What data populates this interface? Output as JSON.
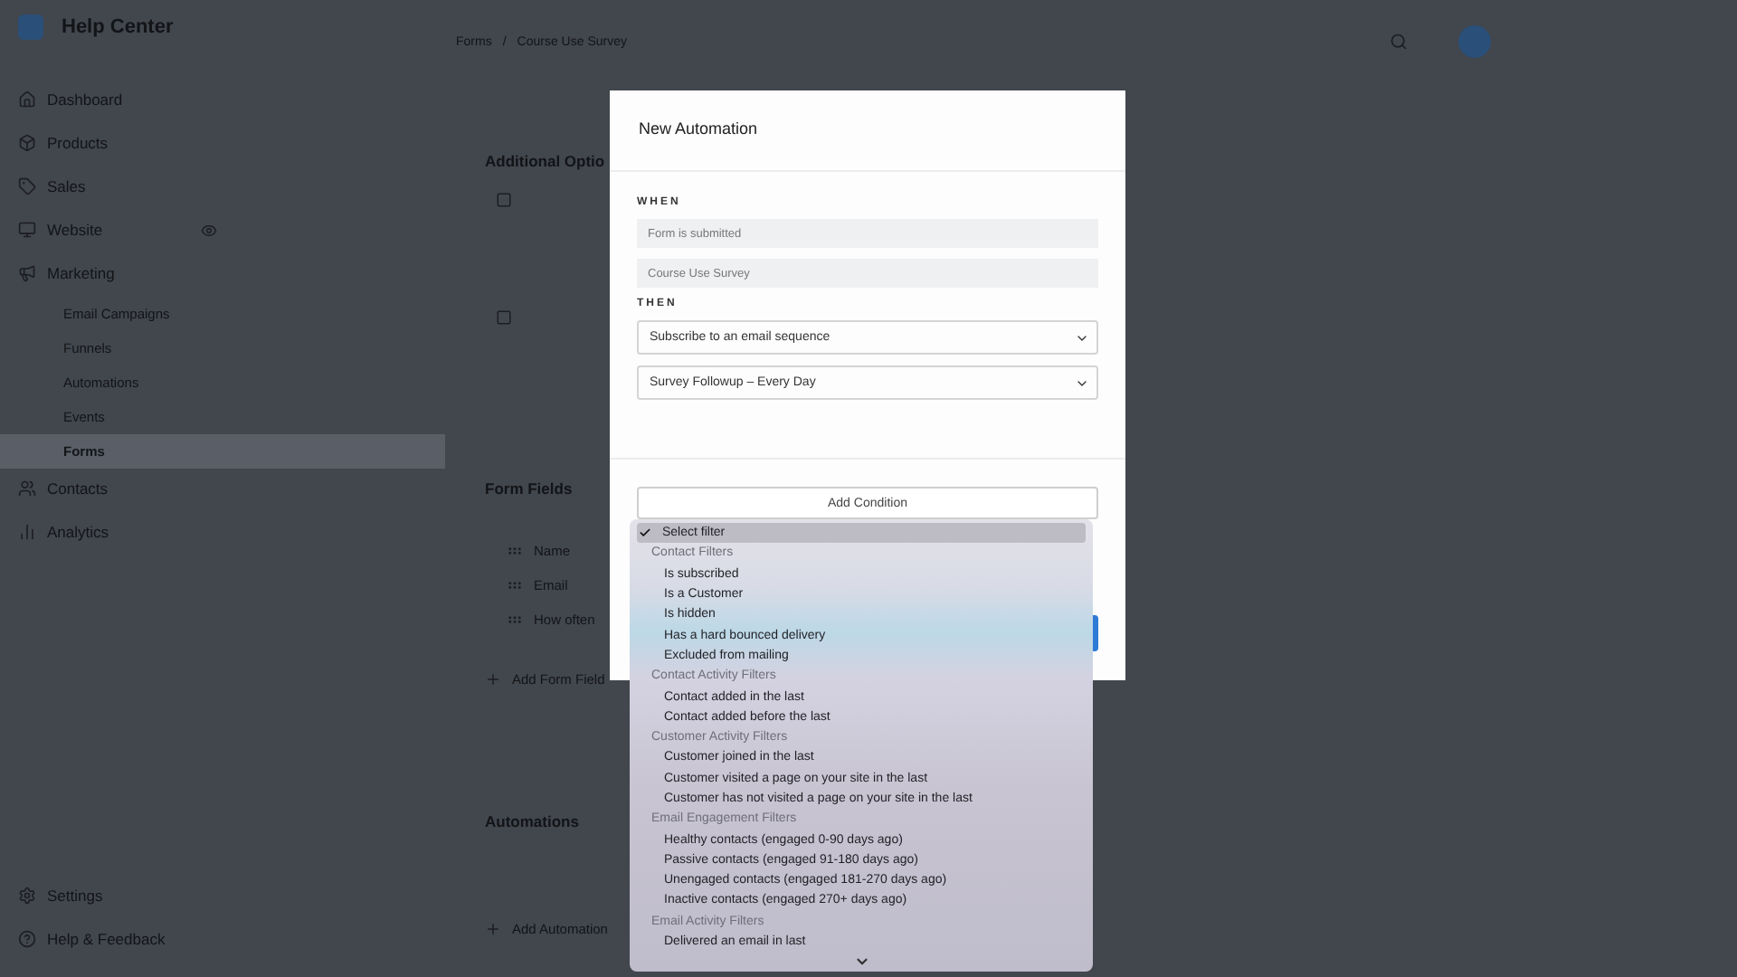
{
  "sidebar": {
    "app_name": "Help Center",
    "items": [
      {
        "label": "Dashboard",
        "selected": false
      },
      {
        "label": "Products",
        "selected": false
      },
      {
        "label": "Sales",
        "selected": false
      },
      {
        "label": "Website",
        "selected": false
      },
      {
        "label": "Marketing",
        "selected": false,
        "children": [
          {
            "label": "Email Campaigns",
            "selected": false
          },
          {
            "label": "Funnels",
            "selected": false
          },
          {
            "label": "Automations",
            "selected": false
          },
          {
            "label": "Events",
            "selected": false
          },
          {
            "label": "Forms",
            "selected": true
          }
        ]
      },
      {
        "label": "Contacts",
        "selected": false
      },
      {
        "label": "Analytics",
        "selected": false
      }
    ],
    "footer": [
      {
        "label": "Settings"
      },
      {
        "label": "Help & Feedback"
      }
    ]
  },
  "breadcrumb": {
    "items": [
      "Forms",
      "Course Use Survey"
    ],
    "separator": "/"
  },
  "main": {
    "options_title": "Additional Optio",
    "form_fields_title": "Form Fields",
    "fields": [
      "Name",
      "Email",
      "How often"
    ],
    "add_field": "Add Form Field",
    "automations_title": "Automations",
    "add_automation": "Add Automation"
  },
  "modal": {
    "title": "New Automation",
    "when_label": "WHEN",
    "when_fields": [
      "Form is submitted",
      "Course Use Survey"
    ],
    "then_label": "THEN",
    "then_selects": [
      "Subscribe to an email sequence",
      "Survey Followup – Every Day"
    ],
    "add_condition": "Add Condition"
  },
  "filter_menu": {
    "items": [
      {
        "kind": "option",
        "label": "Select filter",
        "selected": true
      },
      {
        "kind": "group",
        "label": "Contact Filters"
      },
      {
        "kind": "option",
        "label": "Is subscribed",
        "selected": false
      },
      {
        "kind": "option",
        "label": "Is a Customer",
        "selected": false
      },
      {
        "kind": "option",
        "label": "Is hidden",
        "selected": false
      },
      {
        "kind": "option",
        "label": "Has a hard bounced delivery",
        "selected": false
      },
      {
        "kind": "option",
        "label": "Excluded from mailing",
        "selected": false
      },
      {
        "kind": "group",
        "label": "Contact Activity Filters"
      },
      {
        "kind": "option",
        "label": "Contact added in the last",
        "selected": false
      },
      {
        "kind": "option",
        "label": "Contact added before the last",
        "selected": false
      },
      {
        "kind": "group",
        "label": "Customer Activity Filters"
      },
      {
        "kind": "option",
        "label": "Customer joined in the last",
        "selected": false
      },
      {
        "kind": "option",
        "label": "Customer visited a page on your site in the last",
        "selected": false
      },
      {
        "kind": "option",
        "label": "Customer has not visited a page on your site in the last",
        "selected": false
      },
      {
        "kind": "group",
        "label": "Email Engagement Filters"
      },
      {
        "kind": "option",
        "label": "Healthy contacts (engaged 0-90 days ago)",
        "selected": false
      },
      {
        "kind": "option",
        "label": "Passive contacts (engaged 91-180 days ago)",
        "selected": false
      },
      {
        "kind": "option",
        "label": "Unengaged contacts (engaged 181-270 days ago)",
        "selected": false
      },
      {
        "kind": "option",
        "label": "Inactive contacts (engaged 270+ days ago)",
        "selected": false
      },
      {
        "kind": "group",
        "label": "Email Activity Filters"
      },
      {
        "kind": "option",
        "label": "Delivered an email in last",
        "selected": false
      }
    ]
  }
}
